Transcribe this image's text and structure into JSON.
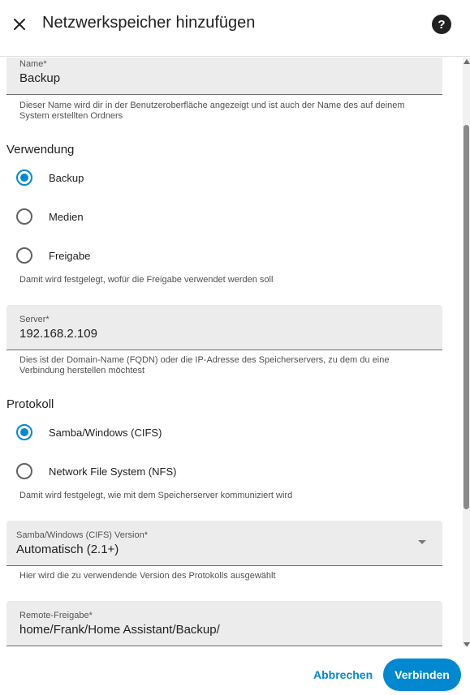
{
  "dialog": {
    "title": "Netzwerkspeicher hinzufügen"
  },
  "name_field": {
    "label": "Name*",
    "value": "Backup",
    "helper": "Dieser Name wird dir in der Benutzeroberfläche angezeigt und ist auch der Name des auf deinem System erstellten Ordners"
  },
  "usage": {
    "title": "Verwendung",
    "options": [
      {
        "label": "Backup",
        "checked": true
      },
      {
        "label": "Medien",
        "checked": false
      },
      {
        "label": "Freigabe",
        "checked": false
      }
    ],
    "helper": "Damit wird festgelegt, wofür die Freigabe verwendet werden soll"
  },
  "server_field": {
    "label": "Server*",
    "value": "192.168.2.109",
    "helper": "Dies ist der Domain-Name (FQDN) oder die IP-Adresse des Speicherservers, zu dem du eine Verbindung herstellen möchtest"
  },
  "protocol": {
    "title": "Protokoll",
    "options": [
      {
        "label": "Samba/Windows (CIFS)",
        "checked": true
      },
      {
        "label": "Network File System (NFS)",
        "checked": false
      }
    ],
    "helper": "Damit wird festgelegt, wie mit dem Speicherserver kommuniziert wird"
  },
  "version_select": {
    "label": "Samba/Windows (CIFS) Version*",
    "value": "Automatisch (2.1+)",
    "helper": "Hier wird die zu verwendende Version des Protokolls ausgewählt"
  },
  "share_field": {
    "label": "Remote-Freigabe*",
    "value": "home/Frank/Home Assistant/Backup/"
  },
  "footer": {
    "cancel_label": "Abbrechen",
    "submit_label": "Verbinden"
  },
  "colors": {
    "accent": "#0288d1",
    "field_bg": "#ececec"
  },
  "icons": {
    "close": "close-icon",
    "help": "help-icon",
    "dropdown": "chevron-down-icon"
  }
}
